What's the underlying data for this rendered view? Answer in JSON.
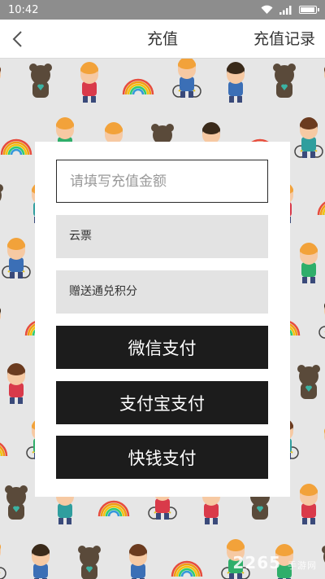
{
  "status_bar": {
    "time": "10:42"
  },
  "nav": {
    "title": "充值",
    "action_label": "充值记录"
  },
  "form": {
    "amount_placeholder": "请填写充值金额",
    "cloud_ticket_label": "云票",
    "bonus_points_label": "赠送通兑积分"
  },
  "payment": {
    "wechat_label": "微信支付",
    "alipay_label": "支付宝支付",
    "kuaiqian_label": "快钱支付"
  },
  "watermark": {
    "number": "2265",
    "text": "手游网"
  },
  "colors": {
    "button": "#1c1c1c",
    "field": "#e3e3e3",
    "status_bar": "#8d8d8d"
  }
}
